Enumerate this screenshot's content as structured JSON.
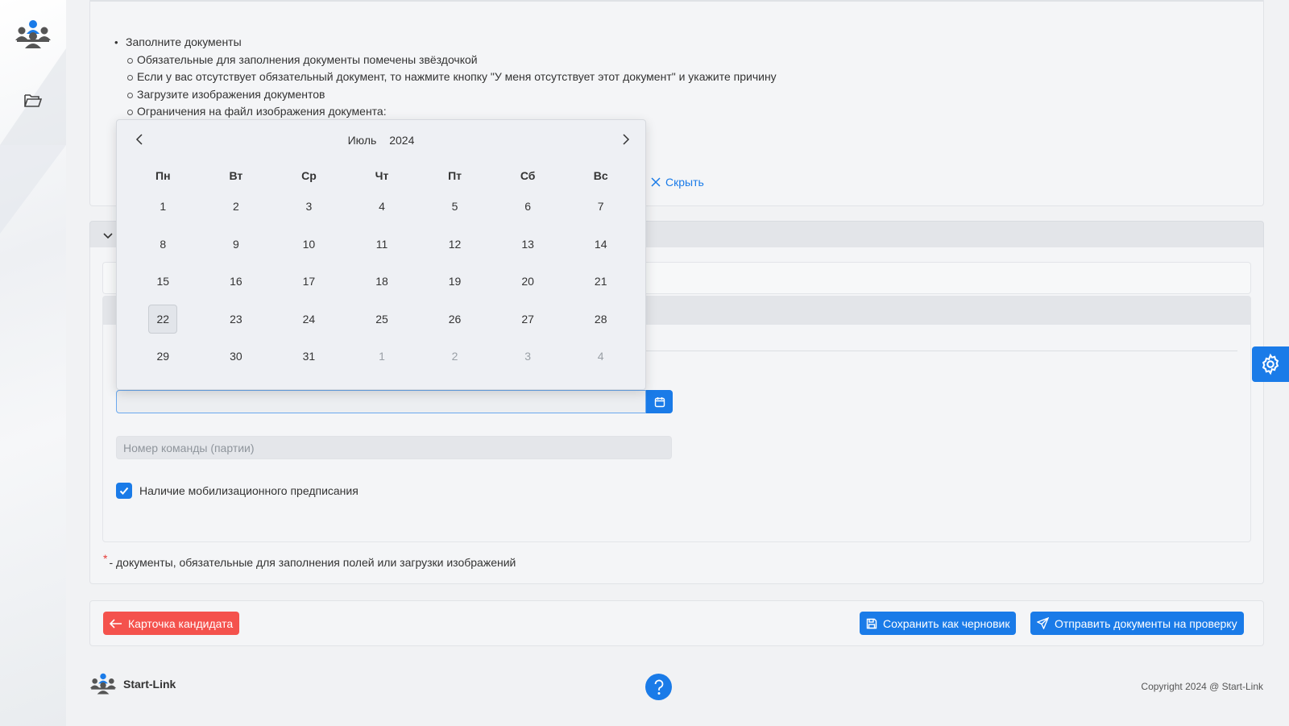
{
  "instructions": {
    "items": [
      {
        "level": 1,
        "text": "Заполните документы"
      },
      {
        "level": 2,
        "text": "Обязательные для заполнения документы помечены звёздочкой"
      },
      {
        "level": 2,
        "text": "Если у вас отсутствует обязательный документ, то нажмите кнопку \"У меня отсутствует этот документ\" и укажите причину"
      },
      {
        "level": 2,
        "text": "Загрузите изображения документов"
      },
      {
        "level": 2,
        "text": "Ограничения на файл изображения документа:"
      }
    ],
    "hide_label": "Скрыть"
  },
  "calendar": {
    "month": "Июль",
    "year": "2024",
    "weekdays": [
      "Пн",
      "Вт",
      "Ср",
      "Чт",
      "Пт",
      "Сб",
      "Вс"
    ],
    "days": [
      {
        "d": "1"
      },
      {
        "d": "2"
      },
      {
        "d": "3"
      },
      {
        "d": "4"
      },
      {
        "d": "5"
      },
      {
        "d": "6"
      },
      {
        "d": "7"
      },
      {
        "d": "8"
      },
      {
        "d": "9"
      },
      {
        "d": "10"
      },
      {
        "d": "11"
      },
      {
        "d": "12"
      },
      {
        "d": "13"
      },
      {
        "d": "14"
      },
      {
        "d": "15"
      },
      {
        "d": "16"
      },
      {
        "d": "17"
      },
      {
        "d": "18"
      },
      {
        "d": "19"
      },
      {
        "d": "20"
      },
      {
        "d": "21"
      },
      {
        "d": "22",
        "today": true
      },
      {
        "d": "23"
      },
      {
        "d": "24"
      },
      {
        "d": "25"
      },
      {
        "d": "26"
      },
      {
        "d": "27"
      },
      {
        "d": "28"
      },
      {
        "d": "29"
      },
      {
        "d": "30"
      },
      {
        "d": "31"
      },
      {
        "d": "1",
        "other": true
      },
      {
        "d": "2",
        "other": true
      },
      {
        "d": "3",
        "other": true
      },
      {
        "d": "4",
        "other": true
      }
    ]
  },
  "form": {
    "date_value": "",
    "team_placeholder": "Номер команды (партии)",
    "mobilization_label": "Наличие мобилизационного предписания",
    "mobilization_checked": true,
    "required_note": "- документы, обязательные для заполнения полей или загрузки изображений",
    "required_star": "*"
  },
  "actions": {
    "back_label": "Карточка кандидата",
    "save_draft_label": "Сохранить как черновик",
    "submit_label": "Отправить документы на проверку"
  },
  "footer": {
    "brand": "Start-Link",
    "copyright": "Copyright 2024 @ Start-Link"
  },
  "colors": {
    "primary": "#1a7be8",
    "danger": "#f4524d"
  }
}
